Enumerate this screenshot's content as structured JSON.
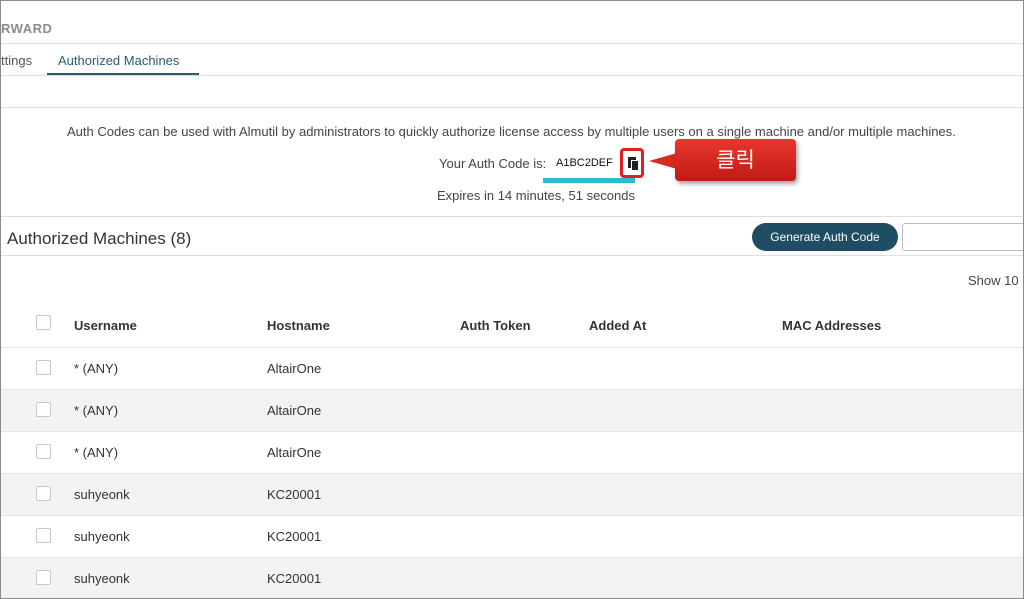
{
  "header": {
    "title": "RWARD"
  },
  "tabs": [
    {
      "label": "ttings"
    },
    {
      "label": "Authorized Machines"
    }
  ],
  "auth": {
    "info": "Auth Codes can be used with Almutil by administrators to quickly authorize license access by multiple users on a single machine and/or multiple machines.",
    "code_label": "Your Auth Code is:",
    "code": "A1BC2DEF",
    "expires": "Expires in 14 minutes, 51 seconds"
  },
  "callout": {
    "text": "클릭",
    "color": "#d62a22"
  },
  "section": {
    "title": "Authorized Machines (8)",
    "generate_label": "Generate Auth Code",
    "search_value": "",
    "show_label": "Show 10"
  },
  "table": {
    "columns": [
      "Username",
      "Hostname",
      "Auth Token",
      "Added At",
      "MAC Addresses"
    ],
    "rows": [
      {
        "username": "* (ANY)",
        "hostname": "AltairOne"
      },
      {
        "username": "* (ANY)",
        "hostname": "AltairOne"
      },
      {
        "username": "* (ANY)",
        "hostname": "AltairOne"
      },
      {
        "username": "suhyeonk",
        "hostname": "KC20001"
      },
      {
        "username": "suhyeonk",
        "hostname": "KC20001"
      },
      {
        "username": "suhyeonk",
        "hostname": "KC20001"
      }
    ]
  },
  "colors": {
    "accent": "#1e4d64",
    "tab_active": "#2c5c6f",
    "highlight": "#2bbdc8",
    "alert": "#e02020"
  }
}
